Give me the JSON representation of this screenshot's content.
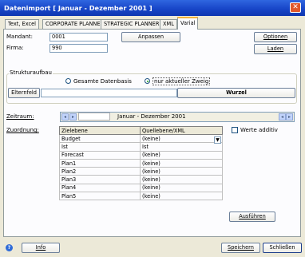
{
  "window": {
    "title": "Datenimport [ Januar - Dezember 2001 ]"
  },
  "tabs": [
    {
      "label": "Text, Excel"
    },
    {
      "label": "CORPORATE PLANNER"
    },
    {
      "label": "STRATEGIC PLANNER"
    },
    {
      "label": "XML"
    },
    {
      "label": "Varial"
    }
  ],
  "form": {
    "mandant_label": "Mandant:",
    "mandant_value": "0001",
    "firma_label": "Firma:",
    "firma_value": "990",
    "anpassen_label": "Anpassen",
    "optionen_label": "Optionen",
    "laden_label": "Laden"
  },
  "struktur": {
    "title": "Strukturaufbau",
    "option1": "Gesamte Datenbasis",
    "option2": "nur aktueller Zweig",
    "elternfeld_label": "Elternfeld",
    "wurzel_label": "Wurzel"
  },
  "zeitraum": {
    "label": "Zeitraum:",
    "value": "Januar - Dezember 2001"
  },
  "zuordnung": {
    "label": "Zuordnung:",
    "columns": [
      "Zielebene",
      "Quellebene/XML"
    ],
    "rows": [
      {
        "ziel": "Budget",
        "quelle": "(keine)"
      },
      {
        "ziel": "Ist",
        "quelle": "Ist"
      },
      {
        "ziel": "Forecast",
        "quelle": "(keine)"
      },
      {
        "ziel": "Plan1",
        "quelle": "(keine)"
      },
      {
        "ziel": "Plan2",
        "quelle": "(keine)"
      },
      {
        "ziel": "Plan3",
        "quelle": "(keine)"
      },
      {
        "ziel": "Plan4",
        "quelle": "(keine)"
      },
      {
        "ziel": "Plan5",
        "quelle": "(keine)"
      }
    ],
    "werte_additiv": "Werte additiv",
    "ausfuehren_label": "Ausführen"
  },
  "footer": {
    "info_label": "Info",
    "speichern_label": "Speichern",
    "schliessen_label": "Schließen"
  },
  "colors": {
    "title_bar": "#1846c8",
    "close_button": "#e0572c",
    "active_tab_accent": "#f4b43e"
  }
}
